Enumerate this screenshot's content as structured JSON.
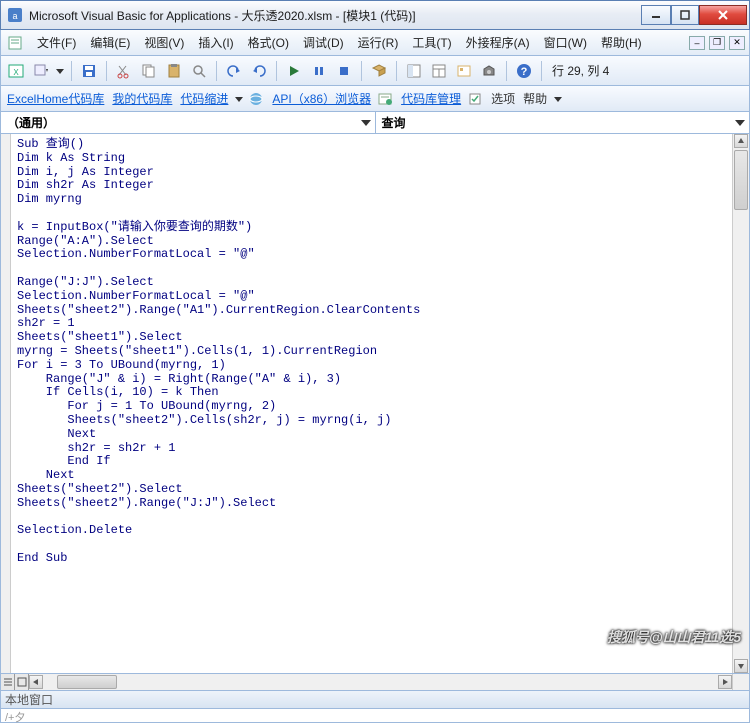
{
  "titlebar": {
    "title": "Microsoft Visual Basic for Applications - 大乐透2020.xlsm - [模块1 (代码)]"
  },
  "menu": {
    "file": "文件(F)",
    "edit": "编辑(E)",
    "view": "视图(V)",
    "insert": "插入(I)",
    "format": "格式(O)",
    "debug": "调试(D)",
    "run": "运行(R)",
    "tools": "工具(T)",
    "addins": "外接程序(A)",
    "window": "窗口(W)",
    "help": "帮助(H)"
  },
  "toolbar": {
    "position": "行 29, 列 4"
  },
  "toolbar2": {
    "item1": "ExcelHome代码库",
    "item2": "我的代码库",
    "item3": "代码缩进",
    "item4": "API（x86）浏览器",
    "item5": "代码库管理",
    "item6": "选项",
    "item7": "帮助"
  },
  "dropdowns": {
    "left": "（通用）",
    "right": "查询"
  },
  "code": "Sub 查询()\nDim k As String\nDim i, j As Integer\nDim sh2r As Integer\nDim myrng\n\nk = InputBox(\"请输入你要查询的期数\")\nRange(\"A:A\").Select\nSelection.NumberFormatLocal = \"@\"\n\nRange(\"J:J\").Select\nSelection.NumberFormatLocal = \"@\"\nSheets(\"sheet2\").Range(\"A1\").CurrentRegion.ClearContents\nsh2r = 1\nSheets(\"sheet1\").Select\nmyrng = Sheets(\"sheet1\").Cells(1, 1).CurrentRegion\nFor i = 3 To UBound(myrng, 1)\n    Range(\"J\" & i) = Right(Range(\"A\" & i), 3)\n    If Cells(i, 10) = k Then\n       For j = 1 To UBound(myrng, 2)\n       Sheets(\"sheet2\").Cells(sh2r, j) = myrng(i, j)\n       Next\n       sh2r = sh2r + 1\n       End If\n    Next\nSheets(\"sheet2\").Select\nSheets(\"sheet2\").Range(\"J:J\").Select\n\nSelection.Delete\n\nEnd Sub",
  "localwin": {
    "title": "本地窗口"
  },
  "bottom": {
    "text": "/+夕"
  },
  "watermark": "搜狐号@山山君11选5"
}
